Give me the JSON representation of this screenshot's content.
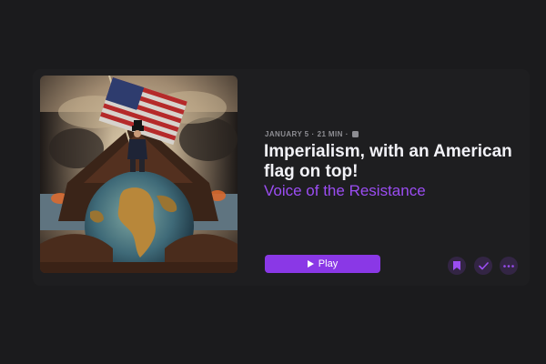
{
  "episode": {
    "date": "JANUARY 5",
    "separator": "·",
    "duration": "21 MIN",
    "explicit_icon": "explicit-badge-icon",
    "title": "Imperialism, with an American flag on top!",
    "show_name": "Voice of the Resistance",
    "artwork_icon": "episode-artwork"
  },
  "actions": {
    "play_label": "Play",
    "play_icon": "play-triangle-icon",
    "bookmark_icon": "bookmark-icon",
    "played_icon": "checkmark-icon",
    "more_icon": "ellipsis-icon"
  },
  "colors": {
    "background": "#1b1b1d",
    "card": "#1e1e20",
    "accent": "#8a38e6",
    "show_link": "#9b4df2",
    "meta_text": "#8e8e93",
    "title_text": "#f2f2f7",
    "icon_button_bg": "#332544"
  }
}
